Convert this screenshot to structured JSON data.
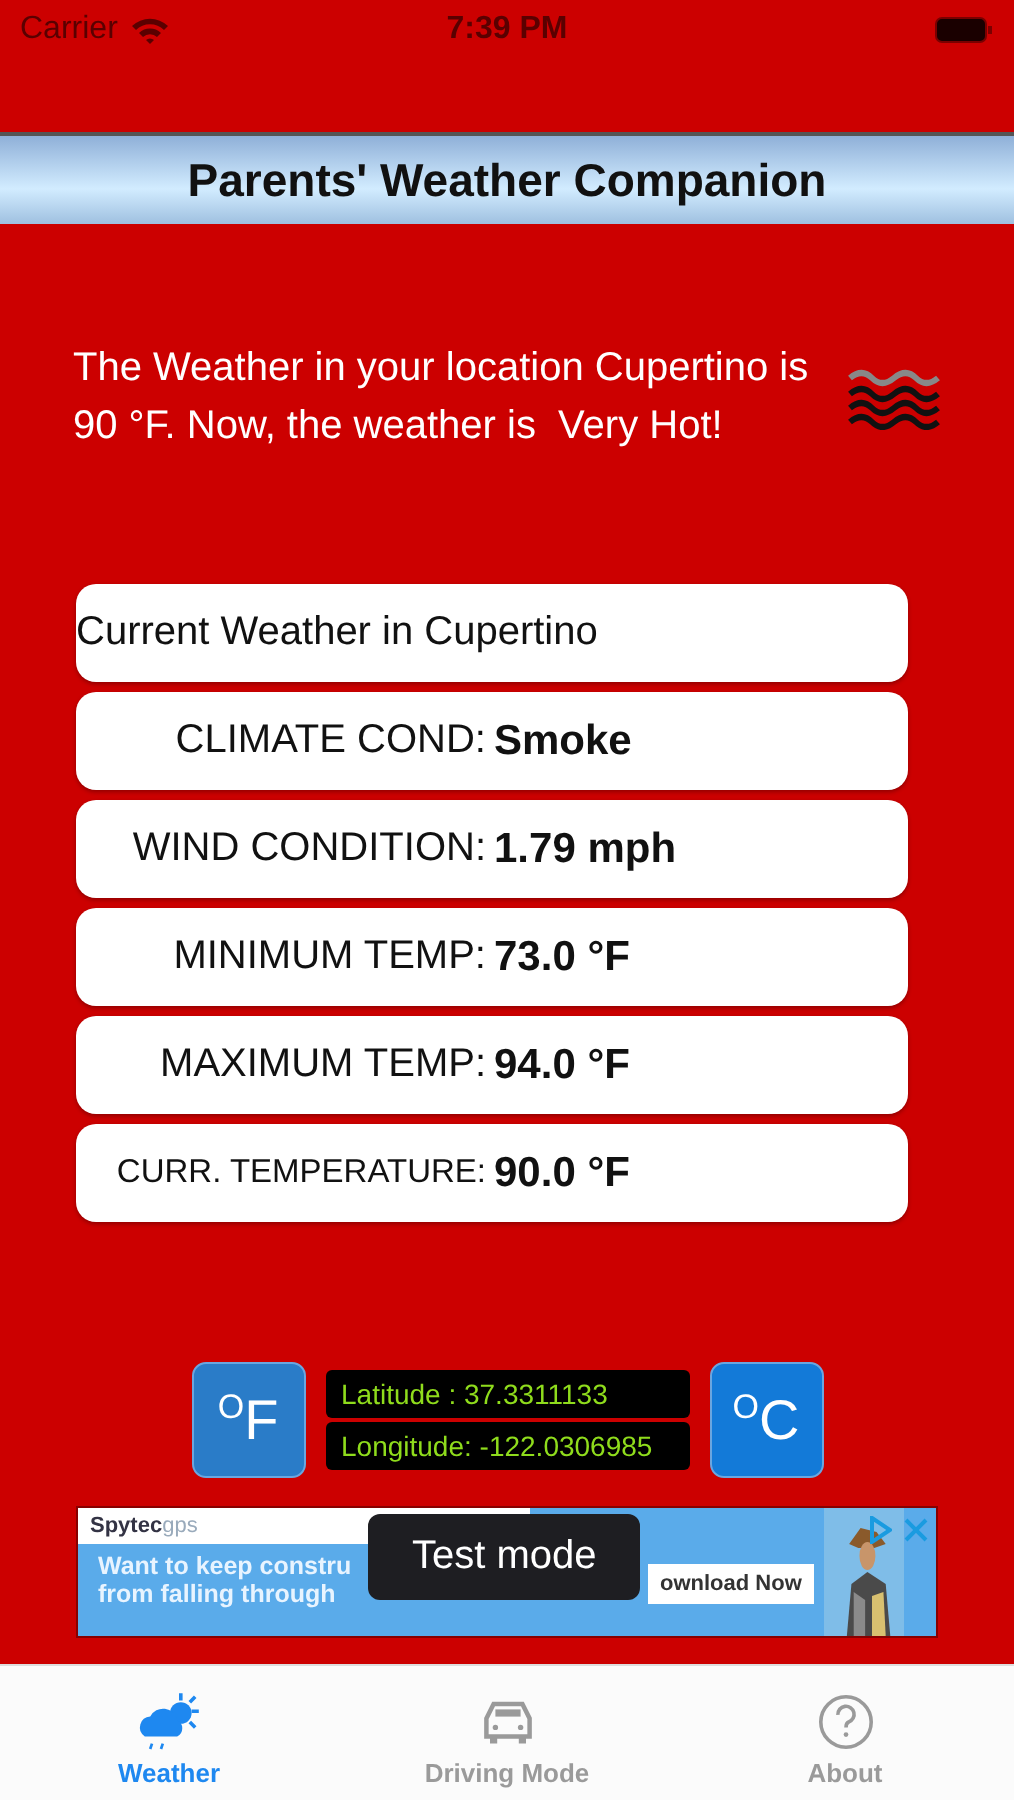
{
  "status_bar": {
    "carrier": "Carrier",
    "time": "7:39 PM"
  },
  "header": {
    "title": "Parents' Weather Companion"
  },
  "message": "The Weather in your location Cupertino is 90 °F. Now, the weather is  Very Hot!",
  "rows": [
    {
      "kind": "heading",
      "label": "Current Weather in  Cupertino"
    },
    {
      "kind": "field",
      "label": "CLIMATE COND:",
      "value": "Smoke"
    },
    {
      "kind": "field",
      "label": "WIND CONDITION:",
      "value": "1.79 mph"
    },
    {
      "kind": "field",
      "label": "MINIMUM TEMP:",
      "value": "73.0 °F"
    },
    {
      "kind": "field",
      "label": "MAXIMUM TEMP:",
      "value": "94.0 °F"
    },
    {
      "kind": "compact",
      "label": "CURR. TEMPERATURE:",
      "value": "90.0 °F"
    }
  ],
  "units": {
    "fahrenheit": {
      "degree": "O",
      "unit": "F"
    },
    "celsius": {
      "degree": "O",
      "unit": "C"
    }
  },
  "coordinates": [
    "Latitude   : 37.3311133",
    "Longitude: -122.0306985"
  ],
  "ad": {
    "brand": "Spytec",
    "brand_suffix": "gps",
    "lines": [
      "Want to keep constru",
      "from falling through"
    ],
    "cta": "ownload Now"
  },
  "toast": "Test mode",
  "tabs": [
    {
      "label": "Weather",
      "selected": true
    },
    {
      "label": "Driving Mode",
      "selected": false
    },
    {
      "label": "About",
      "selected": false
    }
  ]
}
